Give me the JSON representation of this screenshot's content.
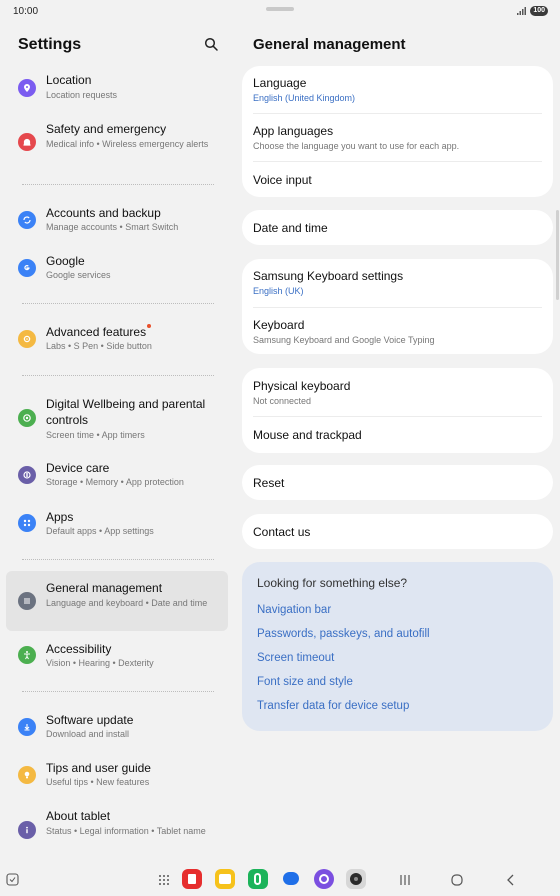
{
  "status": {
    "time": "10:00",
    "battery": "100"
  },
  "left": {
    "title": "Settings",
    "items": [
      {
        "title": "Location",
        "subtitle": "Location requests",
        "icon": "location-pin-icon",
        "color": "#7b5cf0"
      },
      {
        "title": "Safety and emergency",
        "subtitle": "Medical info  •  Wireless emergency alerts",
        "icon": "emergency-bell-icon",
        "color": "#e5484d"
      },
      {
        "title": "Accounts and backup",
        "subtitle": "Manage accounts  •  Smart Switch",
        "icon": "sync-icon",
        "color": "#3b82f6"
      },
      {
        "title": "Google",
        "subtitle": "Google services",
        "icon": "google-icon",
        "color": "#3b82f6"
      },
      {
        "title": "Advanced features",
        "subtitle": "Labs  •  S Pen  •  Side button",
        "icon": "gear-plus-icon",
        "color": "#f4b942"
      },
      {
        "title": "Digital Wellbeing and parental controls",
        "subtitle": "Screen time  •  App timers",
        "icon": "wellbeing-heart-icon",
        "color": "#4caf50"
      },
      {
        "title": "Device care",
        "subtitle": "Storage  •  Memory  •  App protection",
        "icon": "device-care-icon",
        "color": "#6a5fa8"
      },
      {
        "title": "Apps",
        "subtitle": "Default apps  •  App settings",
        "icon": "apps-grid-icon",
        "color": "#3b82f6"
      },
      {
        "title": "General management",
        "subtitle": "Language and keyboard  •  Date and time",
        "icon": "sliders-icon",
        "color": "#6b7280"
      },
      {
        "title": "Accessibility",
        "subtitle": "Vision  •  Hearing  •  Dexterity",
        "icon": "accessibility-icon",
        "color": "#4caf50"
      },
      {
        "title": "Software update",
        "subtitle": "Download and install",
        "icon": "software-update-icon",
        "color": "#3b82f6"
      },
      {
        "title": "Tips and user guide",
        "subtitle": "Useful tips  •  New features",
        "icon": "lightbulb-icon",
        "color": "#f4b942"
      },
      {
        "title": "About tablet",
        "subtitle": "Status  •  Legal information  •  Tablet name",
        "icon": "info-icon",
        "color": "#6a5fa8"
      }
    ]
  },
  "right": {
    "title": "General management",
    "card1": [
      {
        "title": "Language",
        "subtitle": "English (United Kingdom)"
      },
      {
        "title": "App languages",
        "subtitle": "Choose the language you want to use for each app."
      },
      {
        "title": "Voice input"
      }
    ],
    "card2": [
      {
        "title": "Date and time"
      }
    ],
    "card3": [
      {
        "title": "Samsung Keyboard settings",
        "subtitle": "English (UK)"
      },
      {
        "title": "Keyboard",
        "subtitle": "Samsung Keyboard and Google Voice Typing"
      }
    ],
    "card4": [
      {
        "title": "Physical keyboard",
        "subtitle": "Not connected"
      },
      {
        "title": "Mouse and trackpad"
      }
    ],
    "card5": [
      {
        "title": "Reset"
      }
    ],
    "card6": [
      {
        "title": "Contact us"
      }
    ],
    "suggestions": {
      "title": "Looking for something else?",
      "links": [
        "Navigation bar",
        "Passwords, passkeys, and autofill",
        "Screen timeout",
        "Font size and style",
        "Transfer data for device setup"
      ]
    }
  },
  "navbar": {
    "apps": [
      "flipboard-app-icon",
      "notes-app-icon",
      "phone-app-icon",
      "messages-app-icon",
      "internet-app-icon",
      "camera-app-icon"
    ]
  }
}
